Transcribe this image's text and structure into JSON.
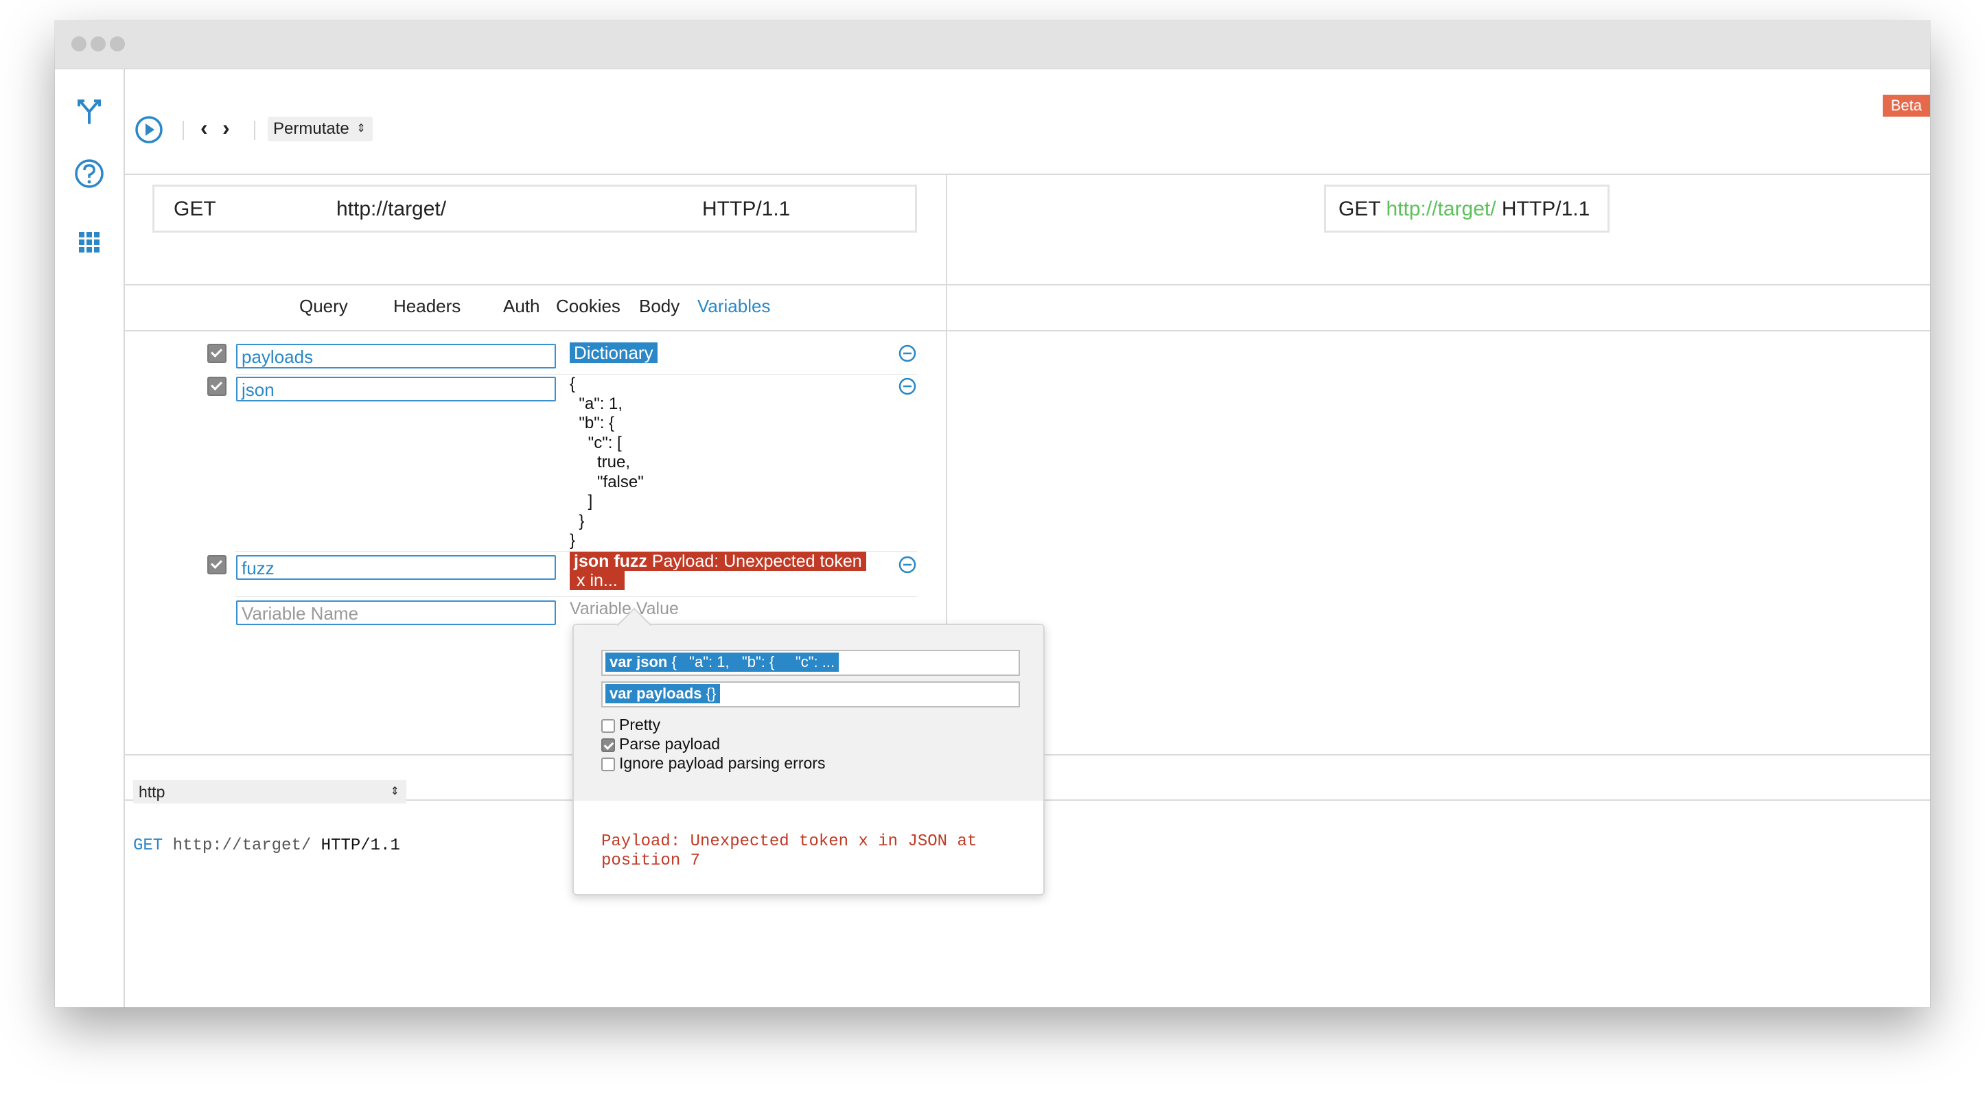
{
  "window": {
    "beta_label": "Beta"
  },
  "toolbar": {
    "run_icon": "play-circle-icon",
    "back_glyph": "‹",
    "forward_glyph": "›",
    "mode_select": "Permutate"
  },
  "request": {
    "method": "GET",
    "url": "http://target/",
    "version": "HTTP/1.1"
  },
  "preview": {
    "method": "GET",
    "url": "http://target/",
    "version": "HTTP/1.1"
  },
  "tabs": [
    "Query",
    "Headers",
    "Auth",
    "Cookies",
    "Body",
    "Variables"
  ],
  "active_tab": "Variables",
  "variables": [
    {
      "enabled": true,
      "name": "payloads",
      "value_tag": "Dictionary"
    },
    {
      "enabled": true,
      "name": "json",
      "value_text": "{\n  \"a\": 1,\n  \"b\": {\n    \"c\": [\n      true,\n      \"false\"\n    ]\n  }\n}"
    },
    {
      "enabled": true,
      "name": "fuzz",
      "error_bold": "json fuzz",
      "error_text": " Payload: Unexpected token",
      "error_line2": "x in..."
    }
  ],
  "new_variable": {
    "name_placeholder": "Variable Name",
    "value_placeholder": "Variable Value"
  },
  "popover": {
    "field1": "var json {   \"a\": 1,   \"b\": {     \"c\": ...",
    "field1_bold": "var json",
    "field2": "var payloads {}",
    "options": [
      {
        "label": "Pretty",
        "checked": false
      },
      {
        "label": "Parse payload",
        "checked": true
      },
      {
        "label": "Ignore payload parsing errors",
        "checked": false
      }
    ],
    "error_message": "Payload: Unexpected token x in JSON at position 7"
  },
  "output": {
    "format_select": "http",
    "raw_method": "GET",
    "raw_url": "http://target/",
    "raw_version": "HTTP/1.1"
  },
  "colors": {
    "accent": "#2a87c8",
    "error": "#c03a25",
    "beta": "#e46a4b",
    "url_green": "#5cc15c"
  }
}
